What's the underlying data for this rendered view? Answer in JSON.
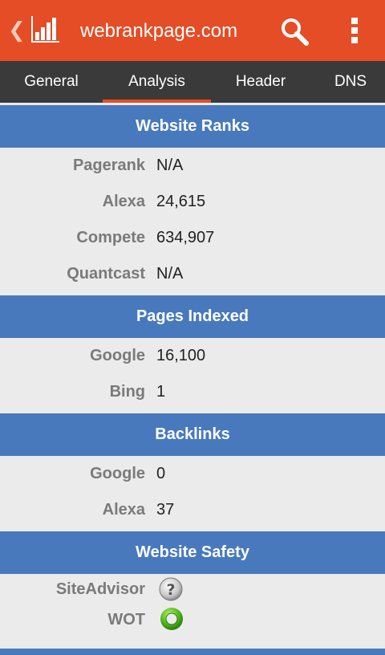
{
  "appbar": {
    "title": "webrankpage.com",
    "back_icon": "chevron-left-icon",
    "logo_icon": "bar-chart-logo-icon",
    "search_icon": "search-icon",
    "overflow_icon": "more-vert-icon",
    "color": "#e44d26"
  },
  "tabs": [
    {
      "label": "General",
      "selected": false
    },
    {
      "label": "Analysis",
      "selected": true
    },
    {
      "label": "Header",
      "selected": false
    },
    {
      "label": "DNS",
      "selected": false
    }
  ],
  "sections": {
    "ranks": {
      "title": "Website Ranks",
      "rows": [
        {
          "label": "Pagerank",
          "value": "N/A"
        },
        {
          "label": "Alexa",
          "value": "24,615"
        },
        {
          "label": "Compete",
          "value": "634,907"
        },
        {
          "label": "Quantcast",
          "value": "N/A"
        }
      ]
    },
    "indexed": {
      "title": "Pages Indexed",
      "rows": [
        {
          "label": "Google",
          "value": "16,100"
        },
        {
          "label": "Bing",
          "value": "1"
        }
      ]
    },
    "backlinks": {
      "title": "Backlinks",
      "rows": [
        {
          "label": "Google",
          "value": "0"
        },
        {
          "label": "Alexa",
          "value": "37"
        }
      ]
    },
    "safety": {
      "title": "Website Safety",
      "rows": [
        {
          "label": "SiteAdvisor",
          "icon": "question-mark-icon"
        },
        {
          "label": "WOT",
          "icon": "green-ring-icon"
        }
      ]
    }
  },
  "colors": {
    "header_bg": "#4879bd",
    "tab_bar_bg": "#3a3a3a",
    "tab_indicator": "#e44d26",
    "label_text": "#7a7a7a"
  }
}
